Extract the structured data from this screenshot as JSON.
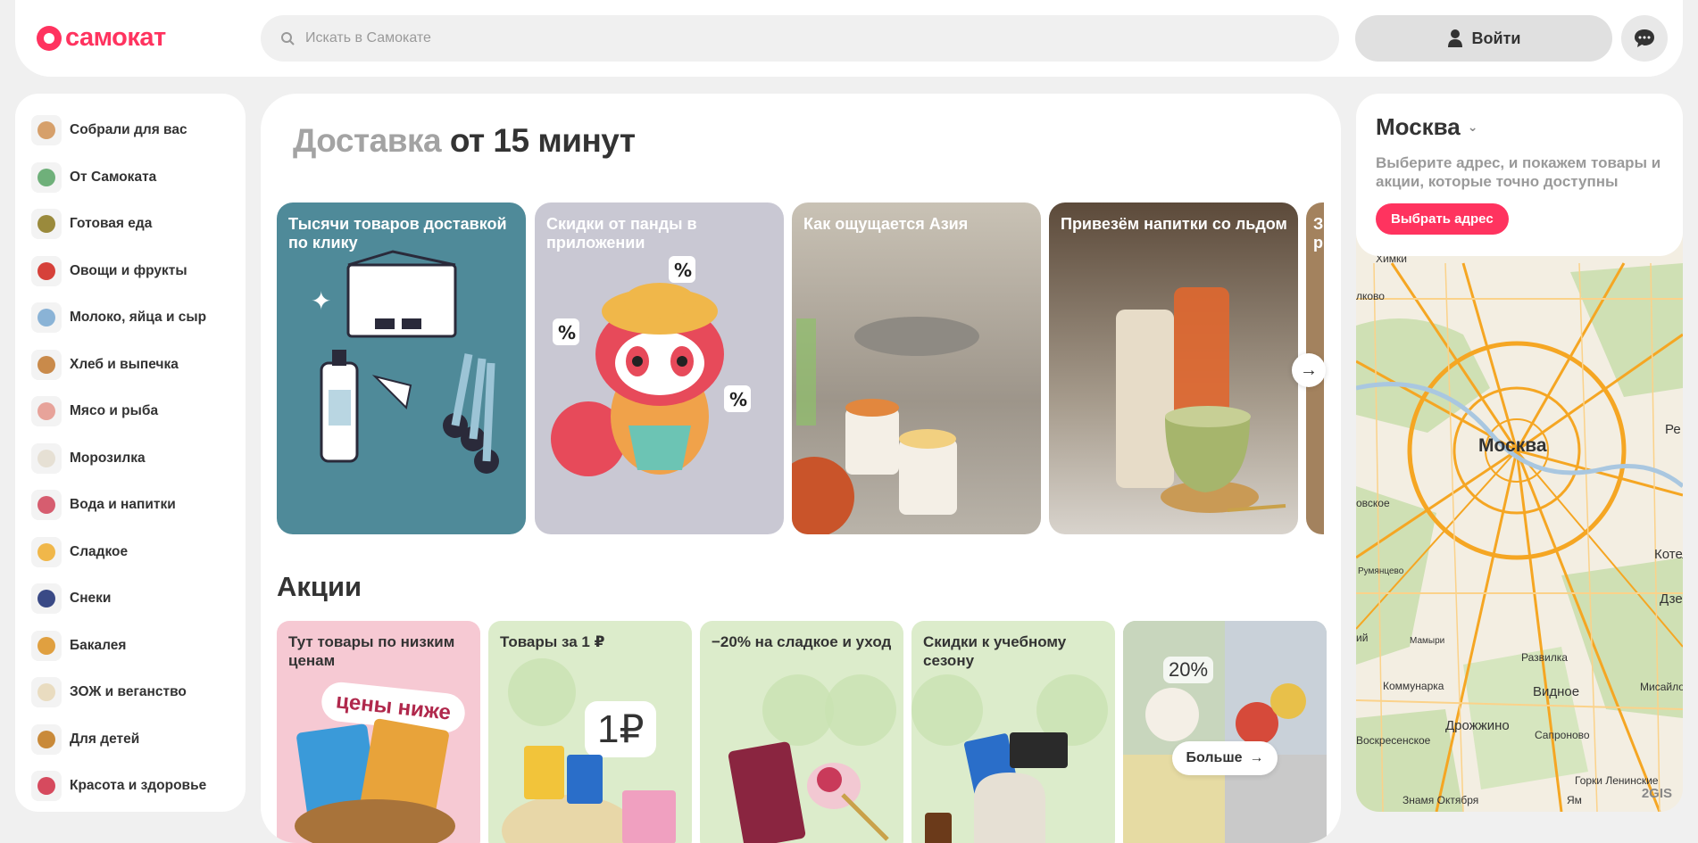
{
  "header": {
    "logo_text": "самокат",
    "search_placeholder": "Искать в Самокате",
    "login_label": "Войти"
  },
  "sidebar": {
    "items": [
      {
        "label": "Собрали для вас",
        "color": "#d6a06b"
      },
      {
        "label": "От Самоката",
        "color": "#6fb07a"
      },
      {
        "label": "Готовая еда",
        "color": "#9a8a3c"
      },
      {
        "label": "Овощи и фрукты",
        "color": "#d6413a"
      },
      {
        "label": "Молоко, яйца и сыр",
        "color": "#8ab3d6"
      },
      {
        "label": "Хлеб и выпечка",
        "color": "#c98a4a"
      },
      {
        "label": "Мясо и рыба",
        "color": "#e7a39a"
      },
      {
        "label": "Морозилка",
        "color": "#e6e0d4"
      },
      {
        "label": "Вода и напитки",
        "color": "#d65d6f"
      },
      {
        "label": "Сладкое",
        "color": "#f0b74a"
      },
      {
        "label": "Снеки",
        "color": "#3a4a86"
      },
      {
        "label": "Бакалея",
        "color": "#e0a040"
      },
      {
        "label": "ЗОЖ и веганство",
        "color": "#e9dcc0"
      },
      {
        "label": "Для детей",
        "color": "#c98a3a"
      },
      {
        "label": "Красота и здоровье",
        "color": "#d64a5e"
      }
    ]
  },
  "main": {
    "title_muted": "Доставка",
    "title_dark": "от 15 минут",
    "banners": [
      {
        "title": "Тысячи товаров доставкой по клику",
        "bg": "#4f8a99"
      },
      {
        "title": "Скидки от панды в приложении",
        "bg": "#c9c8d3"
      },
      {
        "title": "Как ощущается Азия",
        "bg": "#b9b3a9"
      },
      {
        "title": "Привезём напитки со льдом",
        "bg": "#8f8273"
      },
      {
        "title": "З р",
        "bg": "#a3825e"
      }
    ],
    "promo_section_title": "Акции",
    "promos": [
      {
        "title": "Тут товары по низким ценам",
        "bg": "#f6c9d3",
        "badge": "цены ниже"
      },
      {
        "title": "Товары за 1 ₽",
        "bg": "#dceccb",
        "badge": "1₽"
      },
      {
        "title": "−20% на сладкое и уход",
        "bg": "#dceccb"
      },
      {
        "title": "Скидки к учебному сезону",
        "bg": "#dceccb"
      },
      {
        "title": "",
        "bg": "#c9d5c0",
        "badge": "20%",
        "more_label": "Больше"
      }
    ]
  },
  "location": {
    "city": "Москва",
    "hint": "Выберите адрес, и покажем товары и акции, которые точно доступны",
    "button_label": "Выбрать адрес"
  },
  "map": {
    "labels": [
      "Химки",
      "лково",
      "Москва",
      "Ре",
      "овское",
      "Котел",
      "Румянцево",
      "Дзерж",
      "ий",
      "Мамыри",
      "Развилка",
      "Коммунарка",
      "Видное",
      "Мисайлов",
      "Дрожжино",
      "Воскресенское",
      "Сапроново",
      "Горки Ленинские",
      "Знамя Октября",
      "Ям"
    ],
    "brand": "2GIS"
  }
}
